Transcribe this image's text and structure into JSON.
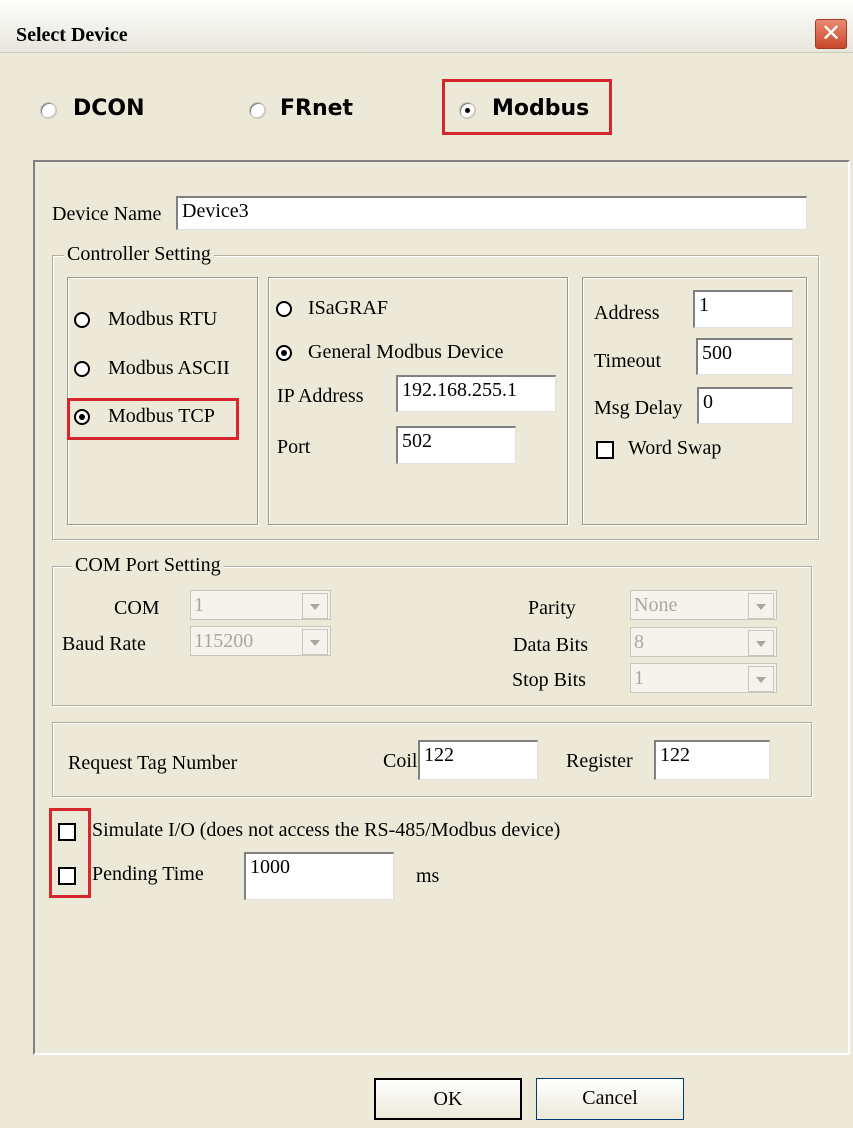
{
  "window": {
    "title": "Select Device",
    "close_glyph": "✕"
  },
  "device_type": {
    "options": [
      "DCON",
      "FRnet",
      "Modbus"
    ],
    "selected": "Modbus"
  },
  "device_name": {
    "label": "Device Name",
    "value": "Device3"
  },
  "controller_setting": {
    "title": "Controller Setting",
    "protocols": [
      "Modbus RTU",
      "Modbus ASCII",
      "Modbus TCP"
    ],
    "selected_protocol": "Modbus TCP",
    "device_kinds": [
      "ISaGRAF",
      "General Modbus Device"
    ],
    "selected_kind": "General Modbus Device",
    "ip_label": "IP Address",
    "ip_value": "192.168.255.1",
    "port_label": "Port",
    "port_value": "502",
    "address_label": "Address",
    "address_value": "1",
    "timeout_label": "Timeout",
    "timeout_value": "500",
    "msg_delay_label": "Msg Delay",
    "msg_delay_value": "0",
    "word_swap_label": "Word Swap"
  },
  "com_port": {
    "title": "COM Port Setting",
    "com_label": "COM",
    "com_value": "1",
    "baud_label": "Baud Rate",
    "baud_value": "115200",
    "parity_label": "Parity",
    "parity_value": "None",
    "data_bits_label": "Data Bits",
    "data_bits_value": "8",
    "stop_bits_label": "Stop Bits",
    "stop_bits_value": "1"
  },
  "request": {
    "label": "Request Tag Number",
    "coil_label": "Coil",
    "coil_value": "122",
    "register_label": "Register",
    "register_value": "122"
  },
  "simulate_io": {
    "label": "Simulate I/O (does not access the RS-485/Modbus device)",
    "checked": false
  },
  "pending_time": {
    "label": "Pending Time",
    "value": "1000",
    "unit": "ms",
    "checked": false
  },
  "buttons": {
    "ok": "OK",
    "cancel": "Cancel"
  },
  "colors": {
    "highlight": "#d8262e",
    "dialog_bg": "#ece9d8",
    "close_button": "#c9462a"
  }
}
